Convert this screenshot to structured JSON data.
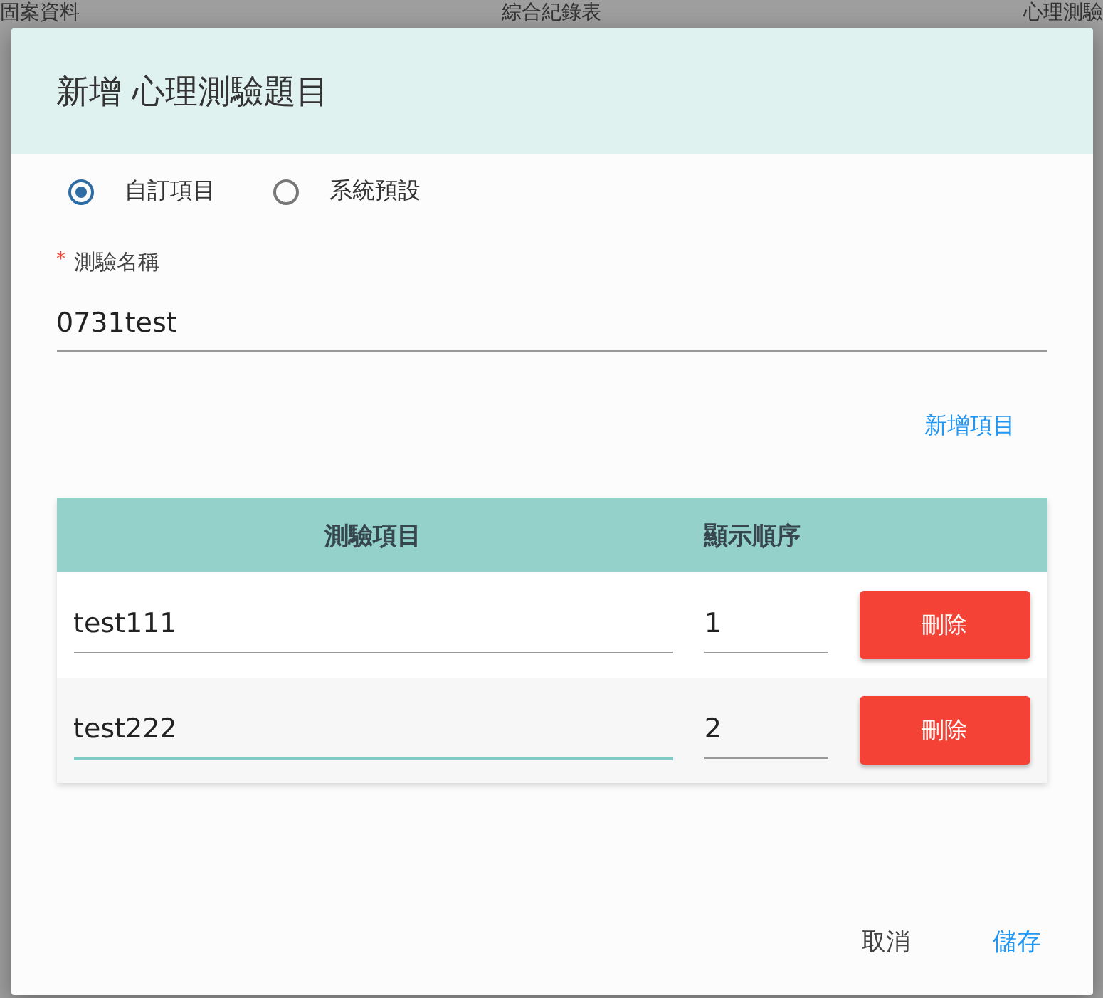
{
  "background_tabs": [
    "固案資料",
    "綜合紀錄表",
    "心理測驗"
  ],
  "dialog": {
    "title": "新增 心理測驗題目",
    "source_options": [
      {
        "label": "自訂項目",
        "selected": true
      },
      {
        "label": "系統預設",
        "selected": false
      }
    ],
    "name_field": {
      "label": "測驗名稱",
      "required_mark": "*",
      "value": "0731test"
    },
    "add_item_link": "新增項目",
    "table": {
      "columns": [
        "測驗項目",
        "顯示順序"
      ],
      "rows": [
        {
          "item": "test111",
          "order": "1",
          "focused": false,
          "delete": "刪除"
        },
        {
          "item": "test222",
          "order": "2",
          "focused": true,
          "delete": "刪除"
        }
      ]
    },
    "buttons": [
      {
        "label": "取消",
        "kind": "secondary"
      },
      {
        "label": "儲存",
        "kind": "primary"
      }
    ]
  }
}
